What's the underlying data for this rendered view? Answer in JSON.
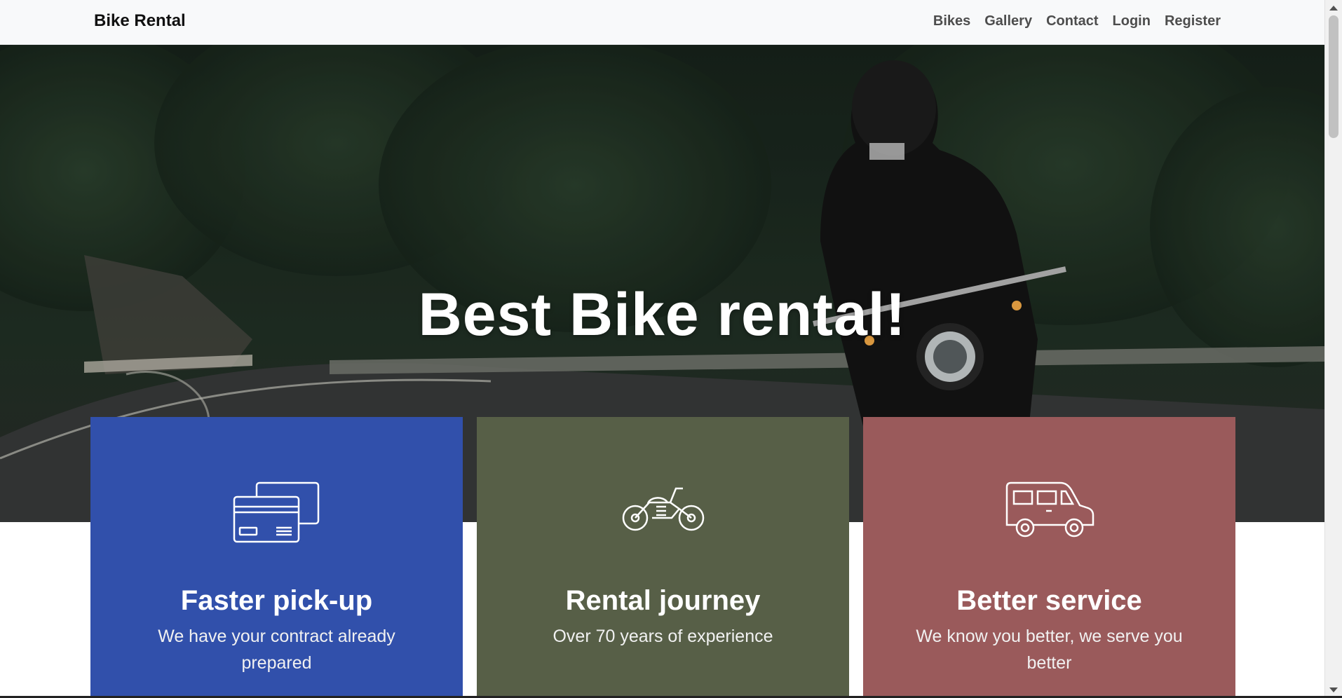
{
  "navbar": {
    "brand": "Bike Rental",
    "links": [
      "Bikes",
      "Gallery",
      "Contact",
      "Login",
      "Register"
    ]
  },
  "hero": {
    "title": "Best Bike rental!"
  },
  "cards": [
    {
      "icon": "credit-card-icon",
      "title": "Faster pick-up",
      "text": "We have your contract already prepared",
      "color": "#3150ab"
    },
    {
      "icon": "motorcycle-icon",
      "title": "Rental journey",
      "text": "Over 70 years of experience",
      "color": "#575f47"
    },
    {
      "icon": "car-icon",
      "title": "Better service",
      "text": "We know you better, we serve you better",
      "color": "#9a5a5b"
    }
  ]
}
